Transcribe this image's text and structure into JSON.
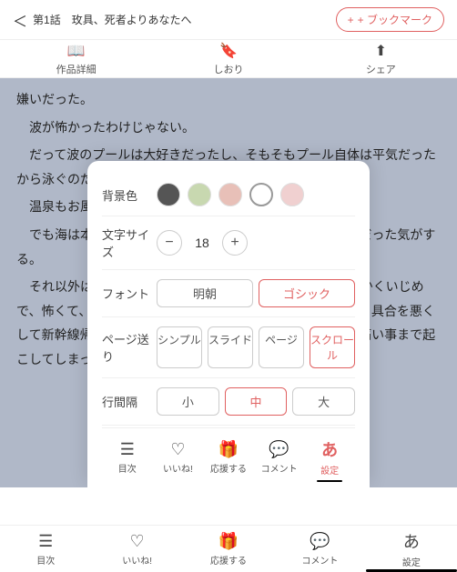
{
  "header": {
    "back_label": "＜",
    "chapter": "第1話　玫具、死者よりあなたへ",
    "bookmark_label": "+ ブックマーク"
  },
  "tabs": [
    {
      "id": "detail",
      "icon": "📖",
      "label": "作品詳細"
    },
    {
      "id": "bookmark",
      "icon": "🔖",
      "label": "しおり"
    },
    {
      "id": "share",
      "icon": "⬆",
      "label": "シェア"
    }
  ],
  "reading": {
    "text_lines": [
      "嫌いだった。",
      "　波が怖かったわけじゃない。",
      "　だって波のプールは大好きだったし、そもそもプール自体は平気だったから泳ぐのだって得意な方だ。",
      "　温泉もお風呂も平気。",
      "　でも海は本当にだめで、泳げなくなって泣き喚いてばかりだった気がする。",
      "　それ以外は親の言う事をよく聞く優等生だったのに、とにかくいじめで、怖くて、ある程度の年学校へ行く事になった時も、あまり具合を悪くして新幹線帰宅するという、完璧主義の両親にとっては頭の痛い事まで起こしてしまった事もあった。"
    ]
  },
  "settings": {
    "title": "設定",
    "bg_color_label": "背景色",
    "swatches": [
      {
        "id": "dark",
        "class": "swatch-dark",
        "selected": false
      },
      {
        "id": "green",
        "class": "swatch-green",
        "selected": false
      },
      {
        "id": "pink",
        "class": "swatch-pink",
        "selected": false
      },
      {
        "id": "red-outline",
        "class": "swatch-red-outline",
        "selected": true
      },
      {
        "id": "light-pink",
        "class": "swatch-light-pink",
        "selected": false
      }
    ],
    "font_size_label": "文字サイズ",
    "font_size_minus": "−",
    "font_size_value": "18",
    "font_size_plus": "+",
    "font_label": "フォント",
    "font_options": [
      {
        "id": "mincho",
        "label": "明朝",
        "active": false
      },
      {
        "id": "gothic",
        "label": "ゴシック",
        "active": true
      }
    ],
    "page_send_label": "ページ送り",
    "page_options": [
      {
        "id": "simple",
        "label": "シンプル",
        "active": false
      },
      {
        "id": "slide",
        "label": "スライド",
        "active": false
      },
      {
        "id": "page",
        "label": "ページ",
        "active": false
      },
      {
        "id": "scroll",
        "label": "スクロール",
        "active": true
      }
    ],
    "line_spacing_label": "行間隔",
    "spacing_options": [
      {
        "id": "small",
        "label": "小",
        "active": false
      },
      {
        "id": "medium",
        "label": "中",
        "active": true
      },
      {
        "id": "large",
        "label": "大",
        "active": false
      }
    ],
    "nav_items": [
      {
        "id": "menu",
        "icon": "☰",
        "label": "目次"
      },
      {
        "id": "like",
        "icon": "♡",
        "label": "いいね!"
      },
      {
        "id": "support",
        "icon": "🎁",
        "label": "応援する"
      },
      {
        "id": "comment",
        "icon": "💬",
        "label": "コメント"
      },
      {
        "id": "settings",
        "icon": "あ",
        "label": "設定",
        "active": true
      }
    ]
  },
  "bottom_nav": {
    "items": [
      {
        "id": "menu",
        "icon": "☰",
        "label": "目次"
      },
      {
        "id": "like",
        "icon": "♡",
        "label": "いいね!"
      },
      {
        "id": "support",
        "icon": "🎁",
        "label": "応援する"
      },
      {
        "id": "comment",
        "icon": "💬",
        "label": "コメント"
      },
      {
        "id": "settings",
        "icon": "あ",
        "label": "設定"
      }
    ]
  }
}
